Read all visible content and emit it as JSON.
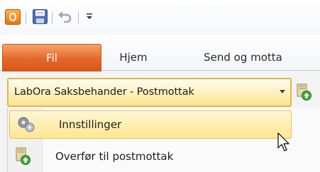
{
  "quick_access": {
    "icons": [
      "outlook-app-icon",
      "save-icon",
      "undo-icon",
      "customize-toolbar-icon"
    ]
  },
  "ribbon": {
    "tabs": [
      {
        "label": "Fil"
      },
      {
        "label": "Hjem"
      },
      {
        "label": "Send og motta"
      }
    ]
  },
  "combo": {
    "value": "LabOra Saksbehander - Postmottak",
    "icon": "chevron-down-icon"
  },
  "menu": {
    "items": [
      {
        "label": "Innstillinger",
        "icon": "gear-icon"
      },
      {
        "label": "Overfør til postmottak",
        "icon": "transfer-icon"
      }
    ]
  },
  "colors": {
    "file_tab": "#e2672a",
    "highlight": "#ffe690",
    "highlight_border": "#e3b44a"
  }
}
